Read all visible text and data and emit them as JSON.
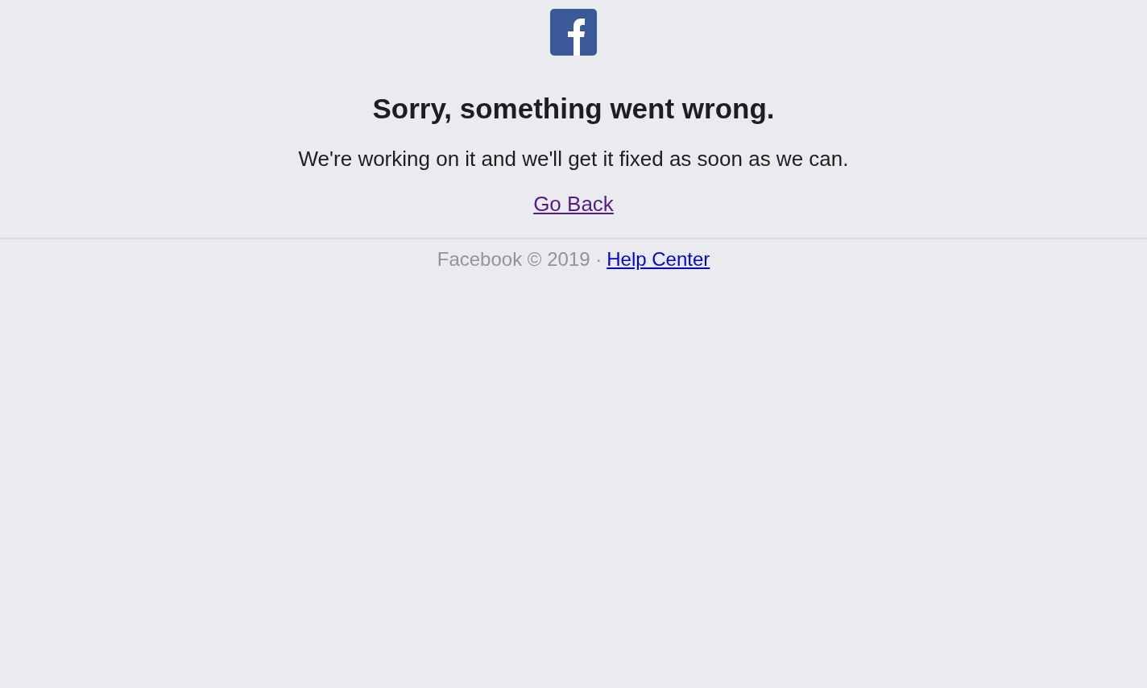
{
  "heading": "Sorry, something went wrong.",
  "message": "We're working on it and we'll get it fixed as soon as we can.",
  "back_link": {
    "label": "Go Back",
    "visited": true
  },
  "footer": {
    "text": "Facebook © 2019 ·",
    "link": {
      "label": "Help Center",
      "visited": false
    }
  }
}
